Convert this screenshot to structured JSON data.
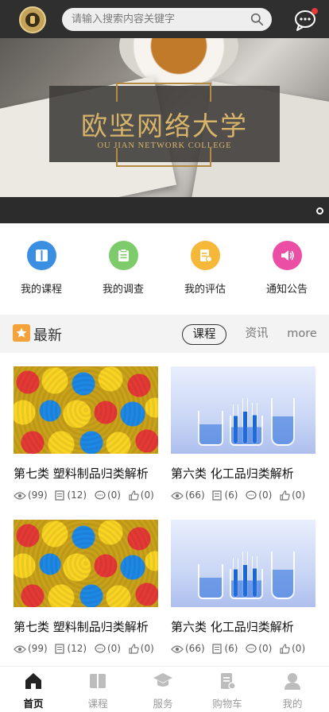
{
  "header": {
    "search_placeholder": "请输入搜索内容关键字"
  },
  "banner": {
    "title_cn": "欧坚网络大学",
    "title_en": "OU JIAN NETWORK COLLEGE"
  },
  "quick_nav": [
    {
      "label": "我的课程",
      "icon": "book-icon",
      "color": "#3b8fe3"
    },
    {
      "label": "我的调查",
      "icon": "survey-icon",
      "color": "#7ecb6b"
    },
    {
      "label": "我的评估",
      "icon": "evaluation-icon",
      "color": "#f5b839"
    },
    {
      "label": "通知公告",
      "icon": "speaker-icon",
      "color": "#ea4fa5"
    }
  ],
  "section": {
    "title": "最新",
    "tabs": [
      "课程",
      "资讯",
      "more"
    ],
    "active_tab": "课程"
  },
  "cards": [
    {
      "title": "第七类 塑料制品归类解析",
      "views": "(99)",
      "notes": "(12)",
      "comments": "(0)",
      "likes": "(0)"
    },
    {
      "title": "第六类 化工品归类解析",
      "views": "(66)",
      "notes": "(6)",
      "comments": "(0)",
      "likes": "(0)"
    },
    {
      "title": "第七类 塑料制品归类解析",
      "views": "(99)",
      "notes": "(12)",
      "comments": "(0)",
      "likes": "(0)"
    },
    {
      "title": "第六类 化工品归类解析",
      "views": "(66)",
      "notes": "(6)",
      "comments": "(0)",
      "likes": "(0)"
    }
  ],
  "bottom_nav": [
    {
      "label": "首页",
      "icon": "home-icon",
      "active": true
    },
    {
      "label": "课程",
      "icon": "course-book-icon",
      "active": false
    },
    {
      "label": "服务",
      "icon": "graduation-cap-icon",
      "active": false
    },
    {
      "label": "购物车",
      "icon": "cart-doc-icon",
      "active": false
    },
    {
      "label": "我的",
      "icon": "user-icon",
      "active": false
    }
  ],
  "colors": {
    "topbar": "#2f2f2f",
    "accent_orange": "#f4a23a",
    "notification_dot": "#e53935"
  }
}
